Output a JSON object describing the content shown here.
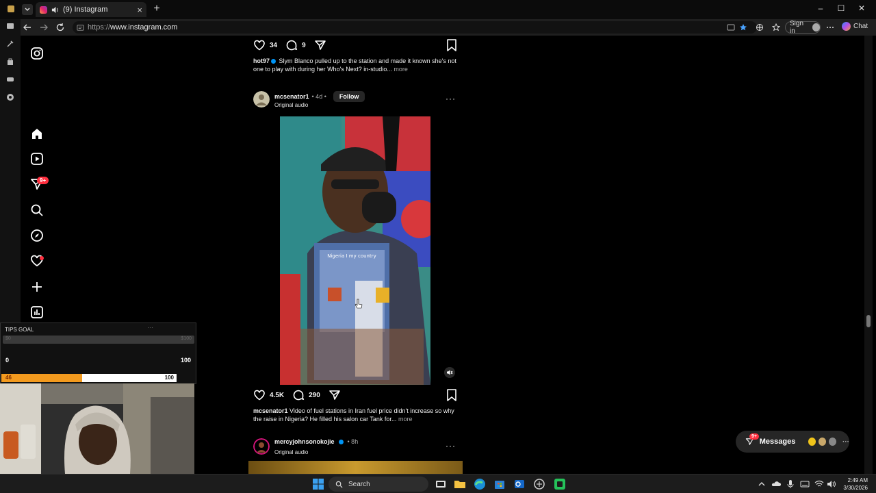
{
  "browser": {
    "tab_title": "(9) Instagram",
    "tab_close": "×",
    "new_tab": "+",
    "url_scheme": "https://",
    "url_host": "www.instagram.com",
    "signin_label": "Sign in",
    "chat_label": "Chat",
    "window_controls": [
      "–",
      "☐",
      "✕"
    ]
  },
  "ig_nav": {
    "notification_badge": "9+"
  },
  "feed": {
    "post1": {
      "likes": "34",
      "comments": "9",
      "caption_user": "hot97",
      "caption_text": "Slym Blanco pulled up to the station and made it known she's not one to play with during her Who's Next? in-studio...",
      "more": "more"
    },
    "post2": {
      "username": "mcsenator1",
      "time": "• 4d •",
      "follow_label": "Follow",
      "audio": "Original audio",
      "menu": "···",
      "video_overlay_text": "Nigeria I my country",
      "likes": "4.5K",
      "comments": "290",
      "caption_user": "mcsenator1",
      "caption_text": "Video of fuel stations in Iran fuel price didn't increase so why the raise in Nigeria? He filled his salon car Tank for...",
      "more": "more"
    },
    "post3": {
      "username": "mercyjohnsonokojie",
      "time": "• 8h",
      "audio": "Original audio",
      "menu": "···"
    }
  },
  "messages": {
    "label": "Messages",
    "badge": "9+",
    "more": "···"
  },
  "overlay": {
    "tips_title": "TIPS GOAL",
    "tips_dots": "···",
    "track_left": "$0",
    "track_right": "$100",
    "goal_min": "0",
    "goal_max": "100",
    "progress_left": "46",
    "progress_right": "100",
    "progress_fraction": 0.46
  },
  "taskbar": {
    "search_label": "Search",
    "time": "2:49 AM",
    "date": "3/30/2026"
  },
  "colors": {
    "ig_red": "#ff3040",
    "ig_blue": "#0095f6",
    "tips_orange": "#f39a1e"
  }
}
